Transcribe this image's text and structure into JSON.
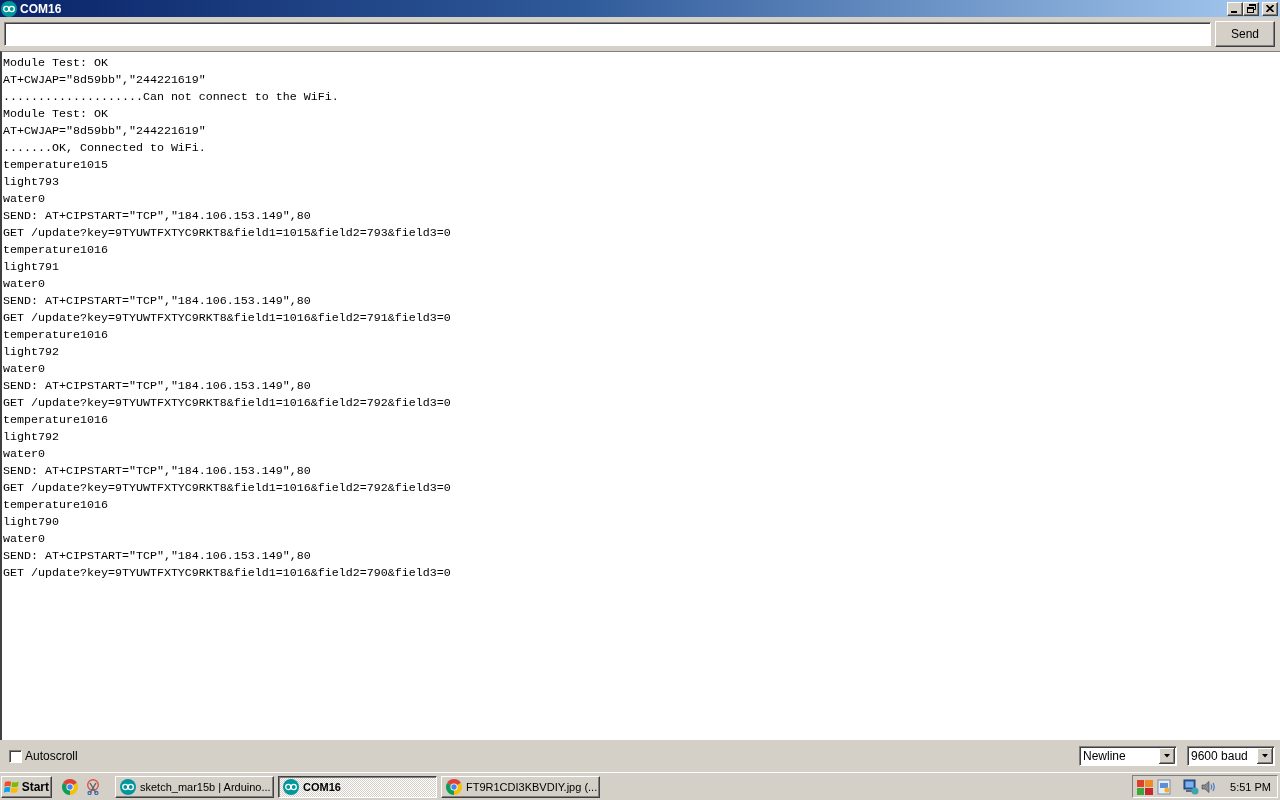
{
  "window": {
    "title": "COM16"
  },
  "send_bar": {
    "button": "Send"
  },
  "output": {
    "lines": [
      "Module Test: OK",
      "AT+CWJAP=\"8d59bb\",\"244221619\"",
      "....................Can not connect to the WiFi.",
      "Module Test: OK",
      "AT+CWJAP=\"8d59bb\",\"244221619\"",
      ".......OK, Connected to WiFi.",
      "temperature1015",
      "light793",
      "water0",
      "SEND: AT+CIPSTART=\"TCP\",\"184.106.153.149\",80",
      "GET /update?key=9TYUWTFXTYC9RKT8&field1=1015&field2=793&field3=0",
      "temperature1016",
      "light791",
      "water0",
      "SEND: AT+CIPSTART=\"TCP\",\"184.106.153.149\",80",
      "GET /update?key=9TYUWTFXTYC9RKT8&field1=1016&field2=791&field3=0",
      "temperature1016",
      "light792",
      "water0",
      "SEND: AT+CIPSTART=\"TCP\",\"184.106.153.149\",80",
      "GET /update?key=9TYUWTFXTYC9RKT8&field1=1016&field2=792&field3=0",
      "temperature1016",
      "light792",
      "water0",
      "SEND: AT+CIPSTART=\"TCP\",\"184.106.153.149\",80",
      "GET /update?key=9TYUWTFXTYC9RKT8&field1=1016&field2=792&field3=0",
      "temperature1016",
      "light790",
      "water0",
      "SEND: AT+CIPSTART=\"TCP\",\"184.106.153.149\",80",
      "GET /update?key=9TYUWTFXTYC9RKT8&field1=1016&field2=790&field3=0"
    ]
  },
  "footer": {
    "autoscroll": {
      "label": "Autoscroll",
      "checked": false
    },
    "line_ending": {
      "value": "Newline"
    },
    "baud_rate": {
      "value": "9600 baud"
    }
  },
  "taskbar": {
    "start": "Start",
    "tasks": [
      {
        "label": "sketch_mar15b | Arduino...",
        "kind": "arduino",
        "selected": false
      },
      {
        "label": "COM16",
        "kind": "arduino",
        "selected": true
      },
      {
        "label": "FT9R1CDI3KBVDIY.jpg (...",
        "kind": "browser",
        "selected": false
      }
    ],
    "clock": "5:51 PM"
  }
}
